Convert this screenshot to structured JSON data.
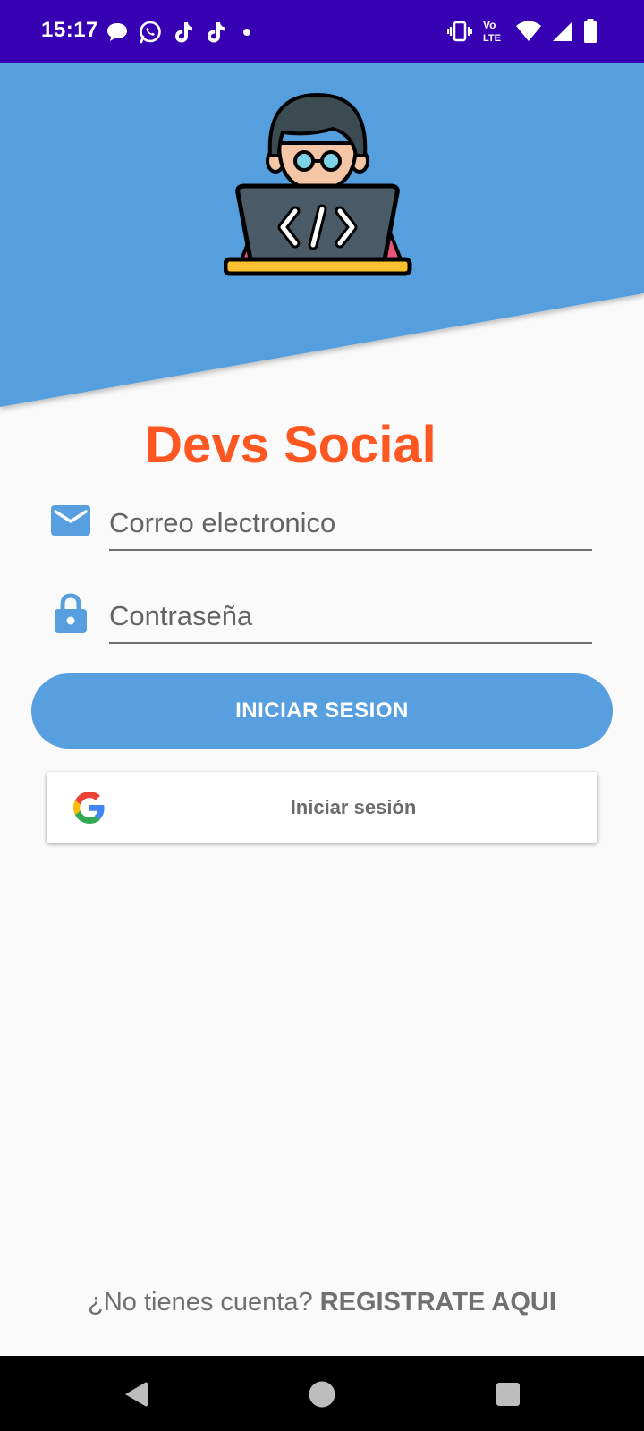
{
  "status_bar": {
    "time": "15:17",
    "left_icons": [
      "chat-bubble-icon",
      "whatsapp-icon",
      "tiktok-icon",
      "tiktok-icon",
      "dot-icon"
    ],
    "right_icons": [
      "vibrate-icon",
      "volte-icon",
      "wifi-icon",
      "signal-icon",
      "battery-icon"
    ],
    "volte_label": [
      "Vo",
      "LTE"
    ]
  },
  "header": {
    "background_color": "#579fdf",
    "illustration": "developer-laptop-illustration"
  },
  "app_title": "Devs Social",
  "form": {
    "email": {
      "icon": "mail-icon",
      "placeholder": "Correo electronico",
      "value": ""
    },
    "password": {
      "icon": "lock-icon",
      "placeholder": "Contraseña",
      "value": ""
    }
  },
  "login_button_label": "INICIAR SESION",
  "google_button": {
    "icon": "google-icon",
    "label": "Iniciar sesión"
  },
  "register": {
    "prefix": "¿No tienes cuenta?",
    "link": "REGISTRATE AQUI"
  },
  "nav_bar": {
    "buttons": [
      "back-icon",
      "home-icon",
      "recents-icon"
    ]
  },
  "colors": {
    "status_bar": "#3700b3",
    "accent_blue": "#579fdf",
    "title_orange": "#ff5722",
    "background": "#fafafa"
  }
}
